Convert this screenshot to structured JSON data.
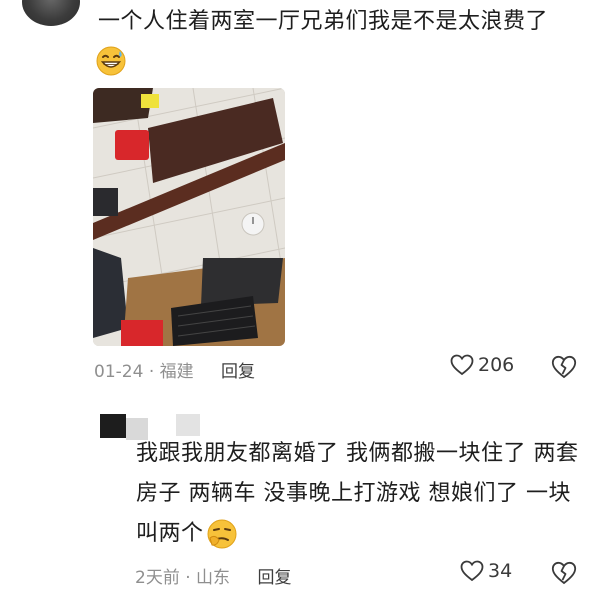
{
  "comment1": {
    "text": "一个人住着两室一厅兄弟们我是不是太浪费了",
    "emoji": "grinning-sweat-emoji",
    "date": "01-24",
    "dot": "·",
    "location": "福建",
    "reply_label": "回复",
    "likes": "206"
  },
  "comment2": {
    "text": "我跟我朋友都离婚了 我俩都搬一块住了  两套房子 两辆车 没事晚上打游戏 想娘们了 一块叫两个",
    "emoji": "thinking-smirk-emoji",
    "date": "2天前",
    "dot": "·",
    "location": "山东",
    "reply_label": "回复",
    "likes": "34"
  },
  "colors": {
    "text": "#1e1e1e",
    "meta": "#8f8f8f",
    "icon": "#3a3a3a"
  }
}
